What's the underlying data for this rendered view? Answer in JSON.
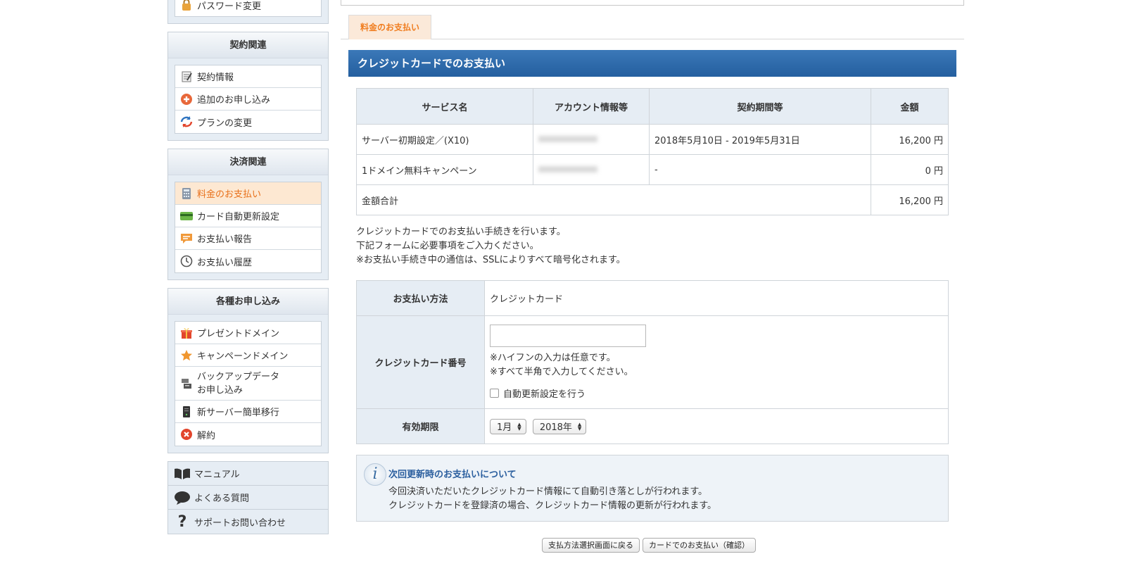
{
  "sidebar": {
    "top_item": "パスワード変更",
    "contract": {
      "title": "契約関連",
      "items": [
        "契約情報",
        "追加のお申し込み",
        "プランの変更"
      ]
    },
    "payment": {
      "title": "決済関連",
      "items": [
        "料金のお支払い",
        "カード自動更新設定",
        "お支払い報告",
        "お支払い履歴"
      ]
    },
    "apply": {
      "title": "各種お申し込み",
      "items": [
        "プレゼントドメイン",
        "キャンペーンドメイン",
        "バックアップデータ",
        "お申し込み",
        "新サーバー簡単移行",
        "解約"
      ]
    },
    "links": [
      "マニュアル",
      "よくある質問",
      "サポートお問い合わせ"
    ]
  },
  "main": {
    "tab": "料金のお支払い",
    "section_title": "クレジットカードでのお支払い",
    "table": {
      "headers": [
        "サービス名",
        "アカウント情報等",
        "契約期間等",
        "金額"
      ],
      "rows": [
        [
          "サーバー初期設定／(X10)",
          "",
          "2018年5月10日 - 2019年5月31日",
          "16,200 円"
        ],
        [
          "1ドメイン無料キャンペーン",
          "",
          "-",
          "0 円"
        ]
      ],
      "total_label": "金額合計",
      "total_value": "16,200 円"
    },
    "notes": [
      "クレジットカードでのお支払い手続きを行います。",
      "下記フォームに必要事項をご入力ください。",
      "※お支払い手続き中の通信は、SSLによりすべて暗号化されます。"
    ],
    "form": {
      "method_label": "お支払い方法",
      "method_value": "クレジットカード",
      "card_label": "クレジットカード番号",
      "card_value": "",
      "hint1": "※ハイフンの入力は任意です。",
      "hint2": "※すべて半角で入力してください。",
      "auto_renew": "自動更新設定を行う",
      "expiry_label": "有効期限",
      "month": "1月",
      "year": "2018年"
    },
    "info": {
      "title": "次回更新時のお支払いについて",
      "line1": "今回決済いただいたクレジットカード情報にて自動引き落としが行われます。",
      "line2": "クレジットカードを登録済の場合、クレジットカード情報の更新が行われます。"
    },
    "buttons": {
      "back": "支払方法選択画面に戻る",
      "confirm": "カードでのお支払い（確認）"
    }
  },
  "colors": {
    "accent_orange": "#f07d1f",
    "header_blue": "#2d6aab",
    "panel_bg": "#e6edf4"
  }
}
